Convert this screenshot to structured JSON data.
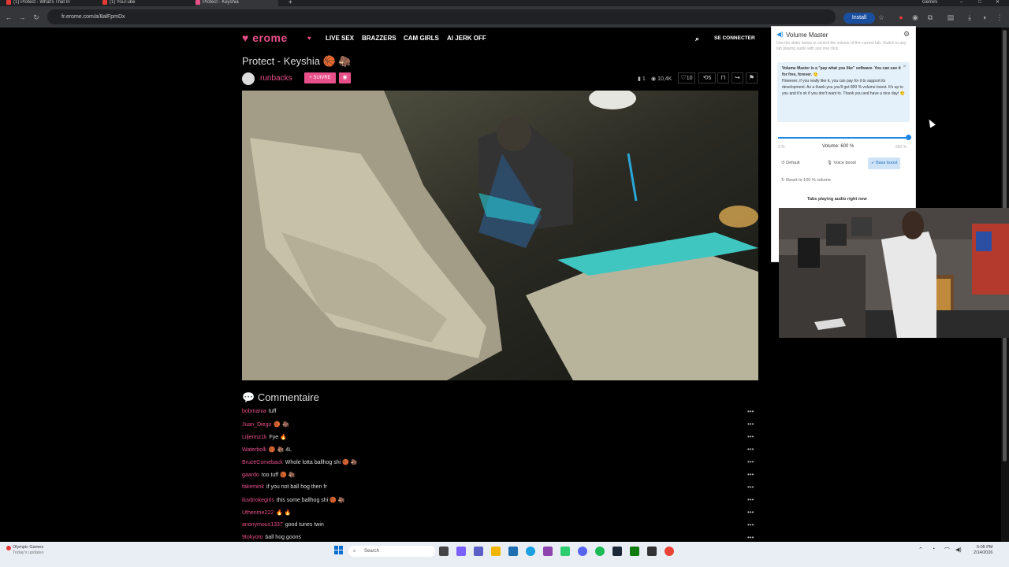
{
  "browser": {
    "tabs": [
      {
        "label": "(1) Protect - What's That In",
        "color": "#e53935"
      },
      {
        "label": "(1) YouTube",
        "color": "#e53935"
      },
      {
        "label": "Protect - Keyshia",
        "color": "#e8508a"
      }
    ],
    "url": "fr.erome.com/a/8alFpmDx",
    "install_label": "Install",
    "gemini_label": "Gemini"
  },
  "site": {
    "logo": "erome",
    "nav": [
      "LIVE SEX",
      "BRAZZERS",
      "CAM GIRLS",
      "AI JERK OFF"
    ],
    "login": "SE CONNECTER"
  },
  "album": {
    "title": "Protect - Keyshia 🏀 🦣",
    "username": "runbacks",
    "follow_label": "+ SUIVRE",
    "video_count": "1",
    "views": "10,4K",
    "likes": "10",
    "reposts": "5"
  },
  "comments": {
    "heading": "Commentaire",
    "items": [
      {
        "user": "bobmania",
        "text": "tuff"
      },
      {
        "user": "Juan_Diego",
        "text": "🏀 🦣"
      },
      {
        "user": "Liljermz1k",
        "text": "Fye 🔥"
      },
      {
        "user": "Waterbolli",
        "text": "🏀 🦣 4L"
      },
      {
        "user": "BruceComeback",
        "text": "Whole lotta ballhog shi 🏀 🦣"
      },
      {
        "user": "gaardo",
        "text": "too tuff 🏀 🦣"
      },
      {
        "user": "fakemink",
        "text": "if you not ball hog then fr"
      },
      {
        "user": "iluvbrokegirls",
        "text": "this some ballhog shi 🏀 🦣"
      },
      {
        "user": "Uthenme222",
        "text": "🔥 🔥"
      },
      {
        "user": "anonymous1337",
        "text": "good tunes twin"
      },
      {
        "user": "9tokyoto",
        "text": "ball hog goons"
      }
    ]
  },
  "volume_master": {
    "title": "Volume Master",
    "subtitle": "Use the slider below to control the volume of the current tab. Switch to any tab playing audio with just one click.",
    "info_line1": "Volume Master is a \"pay what you like\" software. You can use it for free, forever. 🙂",
    "info_line2": "However, if you really like it, you can pay for it to support its development. As a thank-you you'll get 800 % volume boost. It's up to you and it's ok if you don't want to. Thank you and have a nice day! 🙂",
    "scale_min": "0 %",
    "scale_max": "600 %",
    "volume_label": "Volume: 600 %",
    "volume_fraction": 1.0,
    "buttons": [
      "Default",
      "Voice boost",
      "Bass boost"
    ],
    "reset_label": "Reset to 100 % volume",
    "playing_label": "Tabs playing audio right now"
  },
  "taskbar": {
    "weather_title": "Olympic Games",
    "weather_sub": "Today's updates",
    "search_placeholder": "Search",
    "time": "5:05 PM",
    "date": "2/14/2026"
  }
}
